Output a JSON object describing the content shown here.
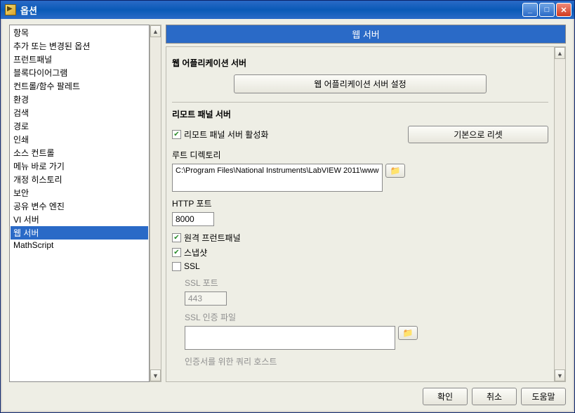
{
  "window": {
    "title": "옵션"
  },
  "sidebar": {
    "items": [
      "항목",
      "추가 또는 변경된 옵션",
      "프런트패널",
      "블록다이어그램",
      "컨트롤/함수 팔레트",
      "환경",
      "검색",
      "경로",
      "인쇄",
      "소스 컨트롤",
      "메뉴 바로 가기",
      "개정 히스토리",
      "보안",
      "공유 변수 엔진",
      "VI 서버",
      "웹 서버",
      "MathScript"
    ],
    "selected_index": 15
  },
  "panel": {
    "title": "웹 서버"
  },
  "app_server": {
    "title": "웹 어플리케이션 서버",
    "config_btn": "웹 어플리케이션 서버 설정"
  },
  "remote": {
    "title": "리모트 패널 서버",
    "enable_label": "리모트 패널 서버 활성화",
    "enable_checked": true,
    "reset_btn": "기본으로 리셋",
    "root_label": "루트 디렉토리",
    "root_value": "C:\\Program Files\\National Instruments\\LabVIEW 2011\\www",
    "http_port_label": "HTTP 포트",
    "http_port_value": "8000",
    "remote_fp_label": "원격 프런트패널",
    "remote_fp_checked": true,
    "snapshot_label": "스냅샷",
    "snapshot_checked": true,
    "ssl_label": "SSL",
    "ssl_checked": false,
    "ssl_port_label": "SSL 포트",
    "ssl_port_value": "443",
    "ssl_file_label": "SSL 인증 파일",
    "ssl_file_value": "",
    "cert_query_label": "인증서를 위한 쿼리 호스트"
  },
  "icons": {
    "folder": "📁"
  },
  "buttons": {
    "ok": "확인",
    "cancel": "취소",
    "help": "도움말"
  }
}
